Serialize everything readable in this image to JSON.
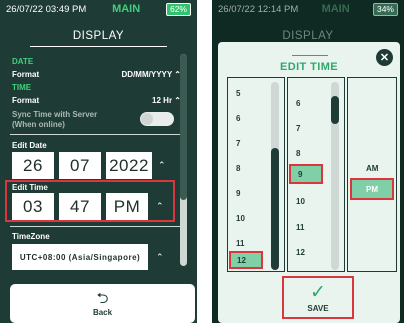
{
  "left": {
    "status": {
      "datetime": "26/07/22 03:49 PM",
      "mode": "MAIN",
      "battery": "62%"
    },
    "title": "DISPLAY",
    "date_section": "DATE",
    "format_label": "Format",
    "date_format": "DD/MM/YYYY",
    "time_section": "TIME",
    "time_format": "12 Hr",
    "sync_label_1": "Sync Time with Server",
    "sync_label_2": "(When online)",
    "edit_date_label": "Edit Date",
    "date_values": [
      "26",
      "07",
      "2022"
    ],
    "edit_time_label": "Edit Time",
    "time_values": [
      "03",
      "47",
      "PM"
    ],
    "timezone_label": "TimeZone",
    "timezone_value": "UTC+08:00 (Asia/Singapore)",
    "back_label": "Back"
  },
  "right": {
    "status": {
      "datetime": "26/07/22 12:14 PM",
      "mode": "MAIN",
      "battery": "34%"
    },
    "bg_title": "DISPLAY",
    "modal_title": "EDIT TIME",
    "hours": [
      "5",
      "6",
      "7",
      "8",
      "9",
      "10",
      "11",
      "12"
    ],
    "selected_hour": "12",
    "minutes": [
      "6",
      "7",
      "8",
      "9",
      "10",
      "11",
      "12"
    ],
    "selected_minute": "9",
    "am_label": "AM",
    "pm_label": "PM",
    "selected_period": "PM",
    "save_label": "SAVE"
  },
  "colors": {
    "accent": "#2fc36d",
    "highlight": "#d9363e",
    "bg": "#1f3b35"
  },
  "icons": [
    "chevron-up-icon",
    "back-arrow-icon",
    "close-icon",
    "checkmark-icon"
  ]
}
